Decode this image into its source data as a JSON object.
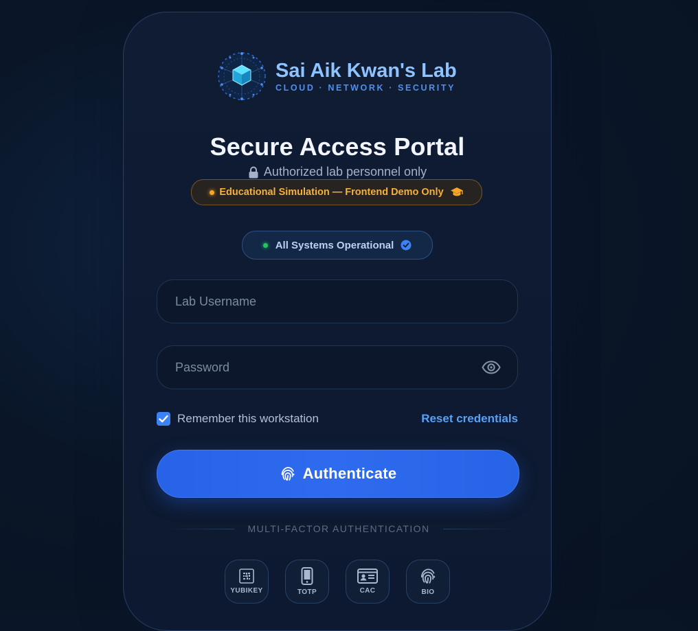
{
  "brand": {
    "name": "Sai Aik Kwan's Lab",
    "tagline": "CLOUD · NETWORK · SECURITY",
    "logo_icon": "network-cube-icon"
  },
  "header": {
    "title": "Secure Access Portal",
    "subtitle": "Authorized lab personnel only",
    "subtitle_icon": "lock-icon"
  },
  "notice": {
    "text": "Educational Simulation — Frontend Demo Only",
    "icon": "graduation-cap-icon",
    "color": "#f5b13d"
  },
  "status": {
    "text": "All Systems Operational",
    "icon": "check-circle-icon",
    "dot_color": "#22c55e"
  },
  "form": {
    "username_placeholder": "Lab Username",
    "username_value": "",
    "password_placeholder": "Password",
    "password_value": "",
    "remember_label": "Remember this workstation",
    "remember_checked": true,
    "reset_link": "Reset credentials",
    "submit_label": "Authenticate",
    "submit_icon": "fingerprint-icon"
  },
  "mfa": {
    "heading": "MULTI-FACTOR AUTHENTICATION",
    "options": [
      {
        "label": "YUBIKEY",
        "icon": "qr-key-icon"
      },
      {
        "label": "TOTP",
        "icon": "smartphone-icon"
      },
      {
        "label": "CAC",
        "icon": "id-card-icon"
      },
      {
        "label": "BIO",
        "icon": "fingerprint-icon"
      }
    ]
  },
  "colors": {
    "accent": "#2f6bee",
    "brand": "#8ec3ff",
    "link": "#5aa0f5",
    "background": "#0a1628"
  }
}
